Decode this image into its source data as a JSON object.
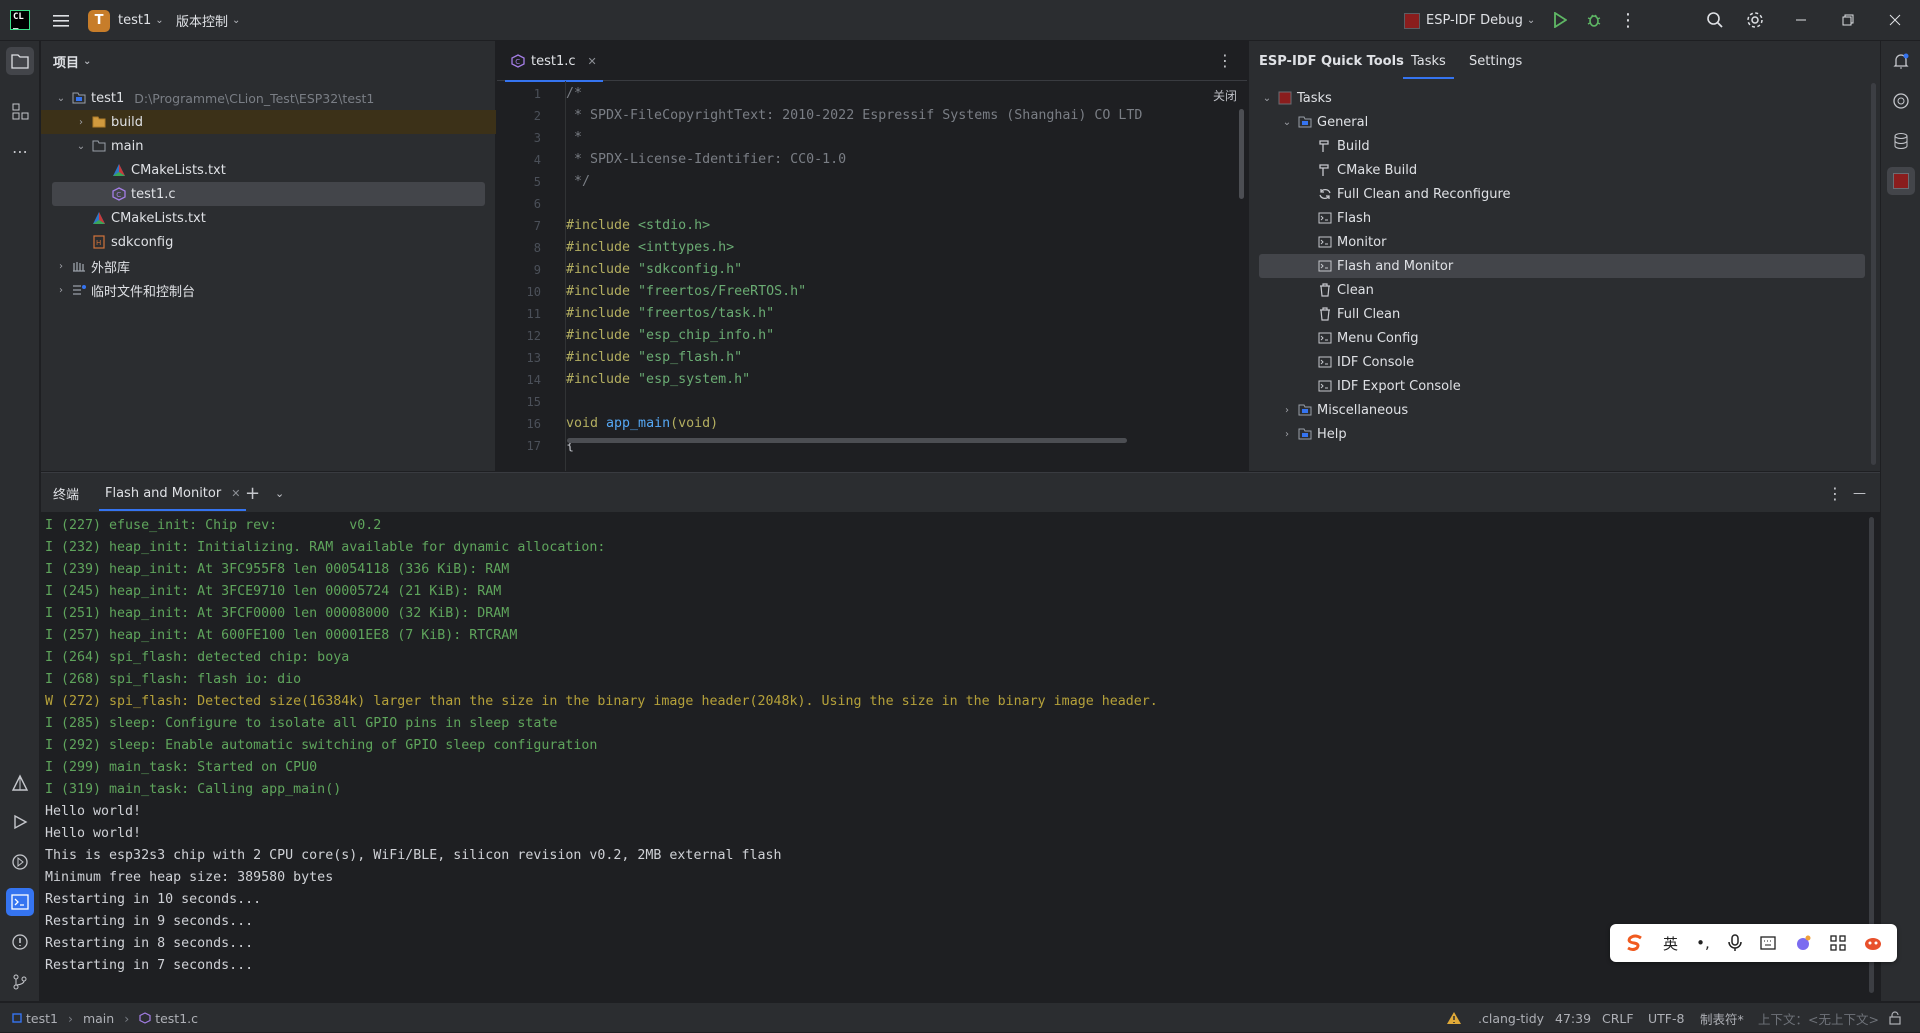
{
  "titlebar": {
    "project_badge": "T",
    "project_name": "test1",
    "vcs_label": "版本控制",
    "run_config": "ESP-IDF Debug"
  },
  "project_panel": {
    "title": "项目",
    "tree": [
      {
        "label": "test1",
        "path": "D:\\Programme\\CLion_Test\\ESP32\\test1",
        "icon": "module-icon"
      },
      {
        "label": "build",
        "icon": "folder-icon"
      },
      {
        "label": "main",
        "icon": "folder-icon"
      },
      {
        "label": "CMakeLists.txt",
        "icon": "cmake-icon"
      },
      {
        "label": "test1.c",
        "icon": "c-file-icon"
      },
      {
        "label": "CMakeLists.txt",
        "icon": "cmake-icon"
      },
      {
        "label": "sdkconfig",
        "icon": "config-file-icon"
      },
      {
        "label": "外部库",
        "icon": "library-icon"
      },
      {
        "label": "临时文件和控制台",
        "icon": "scratch-icon"
      }
    ]
  },
  "editor": {
    "tab_label": "test1.c",
    "close_hint": "关闭",
    "line_numbers": [
      "1",
      "2",
      "3",
      "4",
      "5",
      "6",
      "7",
      "8",
      "9",
      "10",
      "11",
      "12",
      "13",
      "14",
      "15",
      "16",
      "17"
    ],
    "code": {
      "l1": "/*",
      "l2": " * SPDX-FileCopyrightText: 2010-2022 Espressif Systems (Shanghai) CO LTD",
      "l3": " *",
      "l4": " * SPDX-License-Identifier: CC0-1.0",
      "l5": " */",
      "inc": "#include",
      "h1": " <stdio.h>",
      "h2": " <inttypes.h>",
      "h3": " \"sdkconfig.h\"",
      "h4": " \"freertos/FreeRTOS.h\"",
      "h5": " \"freertos/task.h\"",
      "h6": " \"esp_chip_info.h\"",
      "h7": " \"esp_flash.h\"",
      "h8": " \"esp_system.h\"",
      "void": "void",
      "fn": " app_main",
      "args": "(void)",
      "l17": "{"
    }
  },
  "quick_tools": {
    "title": "ESP-IDF Quick Tools",
    "tabs": [
      "Tasks",
      "Settings"
    ],
    "root": "Tasks",
    "general": "General",
    "items": [
      "Build",
      "CMake Build",
      "Full Clean and Reconfigure",
      "Flash",
      "Monitor",
      "Flash and Monitor",
      "Clean",
      "Full Clean",
      "Menu Config",
      "IDF Console",
      "IDF Export Console"
    ],
    "misc": "Miscellaneous",
    "help": "Help"
  },
  "terminal": {
    "title": "终端",
    "active_tab": "Flash and Monitor",
    "lines": [
      {
        "t": "I (227) efuse_init: Chip rev:         v0.2",
        "k": "info"
      },
      {
        "t": "I (232) heap_init: Initializing. RAM available for dynamic allocation:",
        "k": "info"
      },
      {
        "t": "I (239) heap_init: At 3FC955F8 len 00054118 (336 KiB): RAM",
        "k": "info"
      },
      {
        "t": "I (245) heap_init: At 3FCE9710 len 00005724 (21 KiB): RAM",
        "k": "info"
      },
      {
        "t": "I (251) heap_init: At 3FCF0000 len 00008000 (32 KiB): DRAM",
        "k": "info"
      },
      {
        "t": "I (257) heap_init: At 600FE100 len 00001EE8 (7 KiB): RTCRAM",
        "k": "info"
      },
      {
        "t": "I (264) spi_flash: detected chip: boya",
        "k": "info"
      },
      {
        "t": "I (268) spi_flash: flash io: dio",
        "k": "info"
      },
      {
        "t": "W (272) spi_flash: Detected size(16384k) larger than the size in the binary image header(2048k). Using the size in the binary image header.",
        "k": "warn"
      },
      {
        "t": "I (285) sleep: Configure to isolate all GPIO pins in sleep state",
        "k": "info"
      },
      {
        "t": "I (292) sleep: Enable automatic switching of GPIO sleep configuration",
        "k": "info"
      },
      {
        "t": "I (299) main_task: Started on CPU0",
        "k": "info"
      },
      {
        "t": "I (319) main_task: Calling app_main()",
        "k": "info"
      },
      {
        "t": "Hello world!",
        "k": "norm"
      },
      {
        "t": "Hello world!",
        "k": "norm"
      },
      {
        "t": "This is esp32s3 chip with 2 CPU core(s), WiFi/BLE, silicon revision v0.2, 2MB external flash",
        "k": "norm"
      },
      {
        "t": "Minimum free heap size: 389580 bytes",
        "k": "norm"
      },
      {
        "t": "Restarting in 10 seconds...",
        "k": "norm"
      },
      {
        "t": "Restarting in 9 seconds...",
        "k": "norm"
      },
      {
        "t": "Restarting in 8 seconds...",
        "k": "norm"
      },
      {
        "t": "Restarting in 7 seconds...",
        "k": "norm"
      }
    ]
  },
  "ime": {
    "lang": "英"
  },
  "statusbar": {
    "breadcrumb": [
      "test1",
      "main",
      "test1.c"
    ],
    "tidy": ".clang-tidy",
    "position": "47:39",
    "line_sep": "CRLF",
    "encoding": "UTF-8",
    "indent": "制表符*",
    "context": "上下文：<无上下文>"
  },
  "colors": {
    "accent": "#3574f0",
    "info": "#5fa55c",
    "warn": "#b5a13a"
  }
}
